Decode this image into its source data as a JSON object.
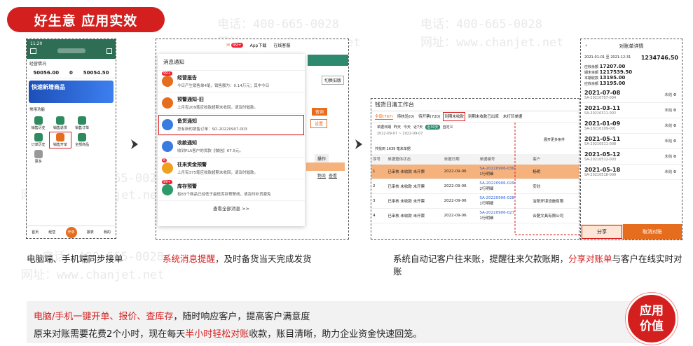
{
  "banner": "好生意  应用实效",
  "watermark": {
    "phone": "电话：400-665-0028",
    "site": "网址：www.chanjet.net"
  },
  "phone": {
    "time": "11:20",
    "tabs_title": "经营情况",
    "stats": [
      {
        "value": "50056.00"
      },
      {
        "value": "0"
      },
      {
        "value": "50054.50"
      }
    ],
    "promo": "快速新增商品",
    "section": "常用功能",
    "grid": [
      "销售历史",
      "销售退货",
      "销售订单",
      "订单历史",
      "销售开单",
      "全部商品",
      "更多"
    ],
    "tabbar": [
      "首页",
      "经营",
      "开单",
      "报表",
      "我的"
    ]
  },
  "notify": {
    "topbar": {
      "msg_count": "99+",
      "download": "App下载",
      "service": "在线客服"
    },
    "header": "消息通知",
    "items": [
      {
        "badge": "99+",
        "title": "经营报告",
        "desc": "今日产生销售单4笔，销售额为：0.14万元；其中今日"
      },
      {
        "badge": "",
        "title": "预警通知-旧",
        "desc": "上月有209笔应收款超期未收回，请及时催款。"
      },
      {
        "badge": "",
        "title": "备货通知",
        "desc": "您有新的销售订单：SO-20220907-003"
      },
      {
        "badge": "",
        "title": "收款通知",
        "desc": "收到PLA客户的货款【微信】67.5元。"
      },
      {
        "badge": "8",
        "title": "往来资金预警",
        "desc": "上月有375笔应收款超期未收回，请及时催款。"
      },
      {
        "badge": "99+",
        "title": "库存预警",
        "desc": "有83个商品已经低于最低库存预警线，请及时补货避免"
      }
    ],
    "footer": "查看全部消息 >>",
    "side": {
      "btn1": "查询",
      "btn2": "设置",
      "col": "操作",
      "links": [
        "物流",
        "查看"
      ],
      "refund": "切换旧版"
    }
  },
  "workbench": {
    "title": "钱货日清工作台",
    "tabs": [
      "全部(767)",
      "待核验(0)",
      "待开票(720)",
      "到期未收款",
      "到期未收款已出库",
      "未打印单据"
    ],
    "filter_label": "单据日期",
    "filter_ranges": [
      "昨天",
      "今天",
      "近7天",
      "近30天",
      "自定义"
    ],
    "date_range": "2022-09-07 ~ 2022-09-07",
    "expand": "展开更多条件",
    "count_label": "共找到 1639 笔未单据",
    "headers": [
      "序号",
      "单据整体状态",
      "单据日期",
      "单据编号",
      "客户"
    ],
    "rows": [
      {
        "no": "1",
        "status": "已审核 未收款 未开票",
        "date": "2022-09-06",
        "code": "SA-20220906-030",
        "sub": "1行明细",
        "cust": "杨明"
      },
      {
        "no": "2",
        "status": "已审核 未收款 未开票",
        "date": "2022-09-06",
        "code": "SA-20220906-029",
        "sub": "2行明细",
        "cust": "安欣"
      },
      {
        "no": "3",
        "status": "已审核 未收款 未开票",
        "date": "2022-09-06",
        "code": "SA-20220906-028",
        "sub": "1行明细",
        "cust": "洁阳环境设施有限"
      },
      {
        "no": "4",
        "status": "已审核 未收款 未开票",
        "date": "2022-09-06",
        "code": "SA-20220906-027",
        "sub": "1行明细",
        "cust": "合肥文具有限公司"
      }
    ]
  },
  "statement": {
    "title": "对账单详情",
    "period": "2021-01-01 至 2021-12-31",
    "total": "1234746.50",
    "summary": [
      {
        "label": "应收余额",
        "value": "17207.00"
      },
      {
        "label": "期末余额",
        "value": "1217539.50"
      },
      {
        "label": "本期收款",
        "value": "13195.00"
      },
      {
        "label": "应收余额",
        "value": "13195.00"
      }
    ],
    "entries": [
      {
        "date": "2021-07-08",
        "code": "SA-20210707-004",
        "status": "未结",
        "amt": "0"
      },
      {
        "date": "2021-03-11",
        "code": "SA-20210311-002",
        "status": "未结",
        "amt": "0"
      },
      {
        "date": "2021-01-09",
        "code": "SA-20210109-001",
        "status": "未结",
        "amt": "0"
      },
      {
        "date": "2021-05-11",
        "code": "SA-20210511-008",
        "status": "未结",
        "amt": "0"
      },
      {
        "date": "2021-05-12",
        "code": "SA-20210512-003",
        "status": "未结",
        "amt": "0"
      },
      {
        "date": "2021-05-18",
        "code": "SA-20210518-009",
        "status": "未结",
        "amt": "0"
      }
    ],
    "share": "分享",
    "cancel": "取消对账"
  },
  "captions": {
    "c1": "电脑端、手机端同步接单",
    "c2_red": "系统消息提醒",
    "c2_rest": "，及时备货当天完成发货",
    "c3_a": "系统自动记客户往来账，提醒往来欠款账期，",
    "c3_red": "分享对账单",
    "c3_b": "与客户在线实时对账"
  },
  "bottom": {
    "l1_red": "电脑/手机一键开单、报价、查库存",
    "l1_rest": "，随时响应客户，提高客户满意度",
    "l2_a": "原来对账需要花费2个小时，现在每天",
    "l2_red": "半小时轻松对账",
    "l2_b": "收款，账目清晰，助力企业资金快速回笼。"
  },
  "value_badge": [
    "应用",
    "价值"
  ],
  "colors": {
    "brand_red": "#d41f1f",
    "orange": "#e66d1e",
    "green": "#2e6e55"
  }
}
